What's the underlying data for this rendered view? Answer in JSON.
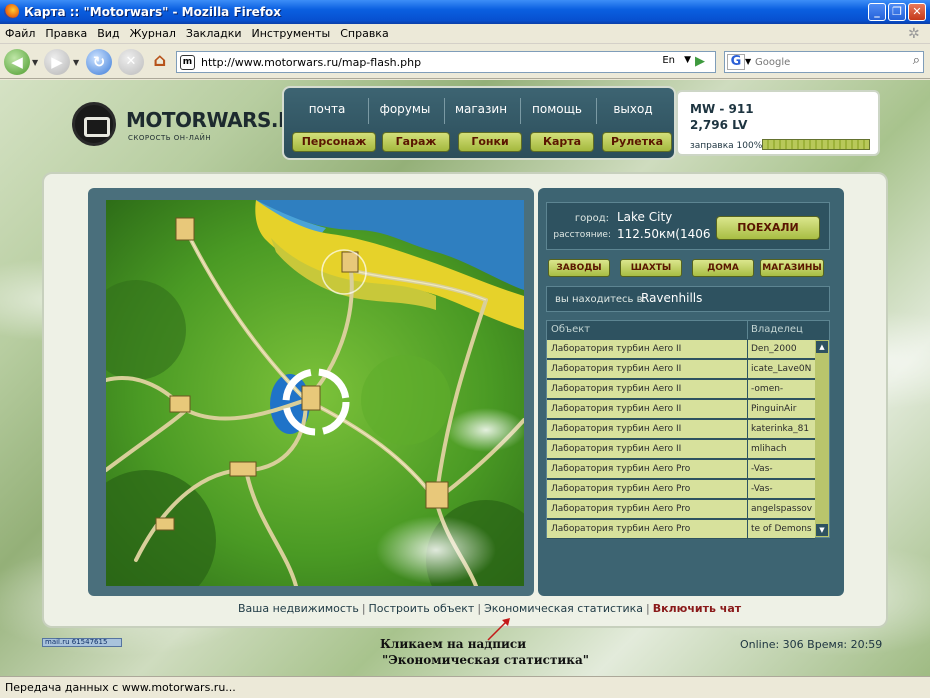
{
  "window": {
    "title": "Карта :: \"Motorwars\" - Mozilla Firefox",
    "controls": [
      "_",
      "❐",
      "✕"
    ]
  },
  "menu": [
    "Файл",
    "Правка",
    "Вид",
    "Журнал",
    "Закладки",
    "Инструменты",
    "Справка"
  ],
  "toolbar": {
    "url": "http://www.motorwars.ru/map-flash.php",
    "lang_badge": "En",
    "search_engine": "G",
    "search_placeholder": "Google"
  },
  "site": {
    "logo_text": "MOTORWARS.RU",
    "logo_sub": "СКОРОСТЬ ОН-ЛАЙН",
    "nav_links": [
      "почта",
      "форумы",
      "магазин",
      "помощь",
      "выход"
    ],
    "nav_buttons": [
      "Персонаж",
      "Гараж",
      "Гонки",
      "Карта",
      "Рулетка"
    ]
  },
  "player": {
    "line1": "MW - 911",
    "line2": "2,796 LV",
    "fuel_label": "заправка 100%",
    "fuel_percent": 100
  },
  "travel": {
    "city_label": "город:",
    "city_value": "Lake City",
    "distance_label": "расстояние:",
    "distance_value": "112.50км(1406",
    "go_button": "ПОЕХАЛИ",
    "categories": [
      "ЗАВОДЫ",
      "ШАХТЫ",
      "ДОМА",
      "МАГАЗИНЫ"
    ],
    "location_label": "вы находитесь в:",
    "location_value": "Ravenhills"
  },
  "objects_table": {
    "headers": [
      "Объект",
      "Владелец"
    ],
    "rows": [
      [
        "Лаборатория турбин Aero II",
        "Den_2000"
      ],
      [
        "Лаборатория турбин Aero II",
        "icate_Lave0N"
      ],
      [
        "Лаборатория турбин Aero II",
        "-omen-"
      ],
      [
        "Лаборатория турбин Aero II",
        "PinguinAir"
      ],
      [
        "Лаборатория турбин Aero II",
        "katerinka_81"
      ],
      [
        "Лаборатория турбин Aero II",
        "mlihach"
      ],
      [
        "Лаборатория турбин Aero Pro",
        "-Vas-"
      ],
      [
        "Лаборатория турбин Aero Pro",
        "-Vas-"
      ],
      [
        "Лаборатория турбин Aero Pro",
        "angelspassov"
      ],
      [
        "Лаборатория турбин Aero Pro",
        "te of Demons"
      ]
    ]
  },
  "bottom_links": [
    "Ваша недвижимость",
    "Построить объект",
    "Экономическая статистика",
    "Включить чат"
  ],
  "counter": "mail.ru 61547615",
  "annotation": {
    "line1": "Кликаем на надписи",
    "line2": "\"Экономическая статистика\""
  },
  "online_status": "Online: 306  Время: 20:59",
  "status_bar": "Передача данных с www.motorwars.ru..."
}
